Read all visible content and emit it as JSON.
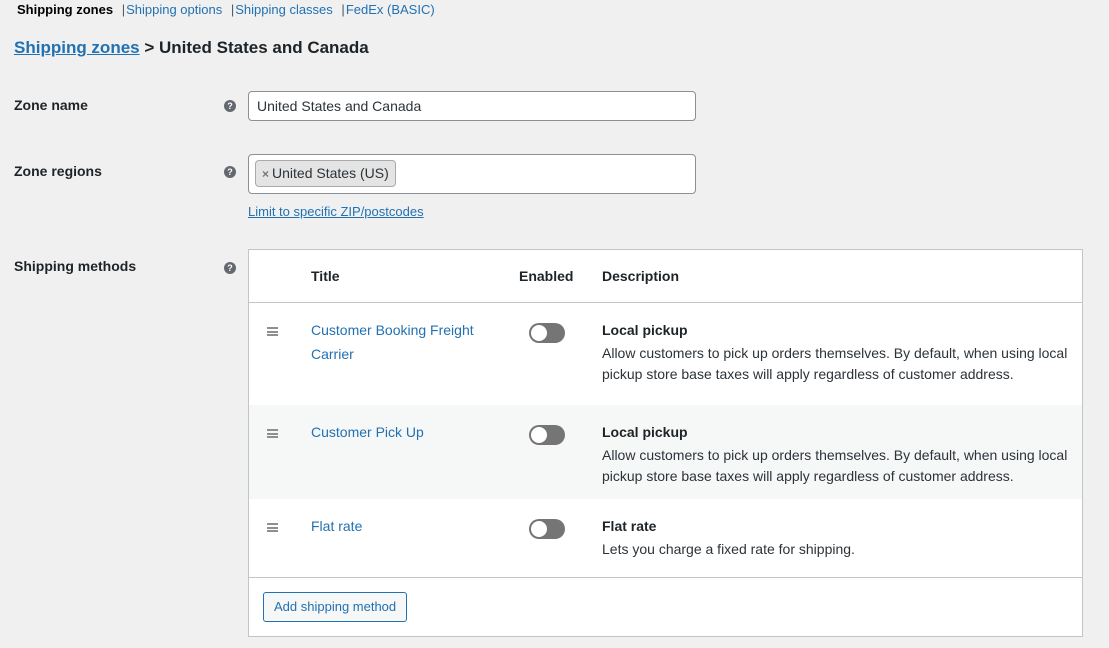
{
  "nav": {
    "items": [
      {
        "label": "Shipping zones",
        "current": true
      },
      {
        "label": "Shipping options",
        "current": false
      },
      {
        "label": "Shipping classes",
        "current": false
      },
      {
        "label": "FedEx (BASIC)",
        "current": false
      }
    ],
    "separator": "|"
  },
  "heading": {
    "link": "Shipping zones",
    "separator": ">",
    "zone": "United States and Canada"
  },
  "zone_name": {
    "label": "Zone name",
    "value": "United States and Canada"
  },
  "zone_regions": {
    "label": "Zone regions",
    "chips": [
      {
        "remove": "×",
        "label": "United States (US)"
      }
    ],
    "limit_link": "Limit to specific ZIP/postcodes"
  },
  "shipping_methods": {
    "label": "Shipping methods",
    "columns": {
      "title": "Title",
      "enabled": "Enabled",
      "description": "Description"
    },
    "rows": [
      {
        "title": "Customer Booking Freight Carrier",
        "enabled": false,
        "type": "Local pickup",
        "description": "Allow customers to pick up orders themselves. By default, when using local pickup store base taxes will apply regardless of customer address."
      },
      {
        "title": "Customer Pick Up",
        "enabled": false,
        "type": "Local pickup",
        "description": "Allow customers to pick up orders themselves. By default, when using local pickup store base taxes will apply regardless of customer address."
      },
      {
        "title": "Flat rate",
        "enabled": false,
        "type": "Flat rate",
        "description": "Lets you charge a fixed rate for shipping."
      }
    ],
    "add_button": "Add shipping method"
  },
  "help_icon": "?",
  "colors": {
    "link": "#2271b1",
    "background": "#f0f0f1",
    "toggle_off": "#757575"
  }
}
